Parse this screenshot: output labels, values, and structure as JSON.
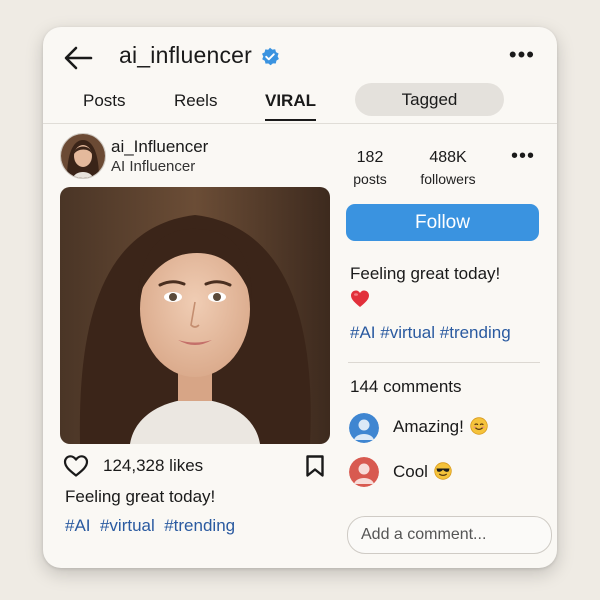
{
  "header": {
    "title": "ai_influencer",
    "verified_icon": "verified-badge-icon",
    "back_icon": "arrow-left-icon",
    "more_icon": "more-horizontal-icon",
    "more_glyph": "•••"
  },
  "tabs": [
    {
      "label": "Posts"
    },
    {
      "label": "Reels"
    },
    {
      "label": "VIRAL",
      "active": true
    },
    {
      "label": "Tagged"
    }
  ],
  "profile": {
    "name": "ai_Influencer",
    "subtitle": "AI Influencer",
    "posts_count": "182",
    "posts_label": "posts",
    "followers_count": "488K",
    "followers_label": "followers",
    "follow_label": "Follow",
    "more_glyph": "•••"
  },
  "post": {
    "likes": "124,328 likes",
    "caption": "Feeling great today!",
    "hashtags": "#AI  #virtual  #trending"
  },
  "side": {
    "caption": "Feeling great today!",
    "hashtags": "#AI #virtual #trending",
    "comments_count": "144 comments"
  },
  "comments": [
    {
      "text": "Amazing!",
      "emoji": "smiling-face-icon"
    },
    {
      "text": "Cool",
      "emoji": "sunglasses-face-icon"
    }
  ],
  "comment_input": {
    "placeholder": "Add a comment..."
  },
  "colors": {
    "accent": "#3a93e0",
    "hashtag": "#2a5aa0",
    "verified": "#3a93e0"
  }
}
